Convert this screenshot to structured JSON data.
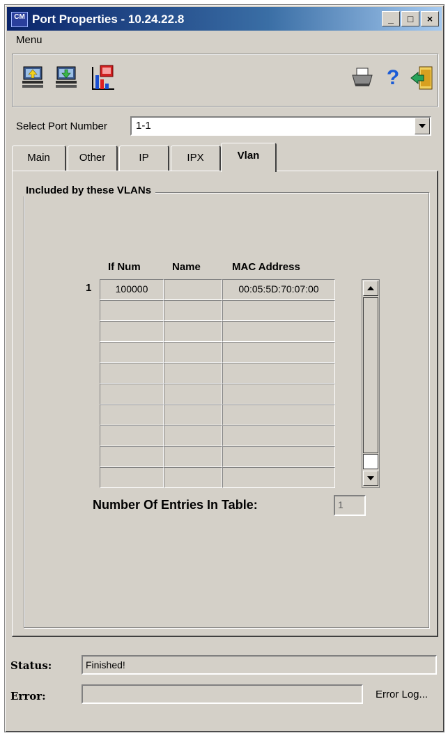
{
  "window": {
    "title": "Port Properties - 10.24.22.8",
    "app_icon_text": "CM",
    "minimize": "_",
    "maximize": "□",
    "close": "×"
  },
  "menu": {
    "items": [
      "Menu"
    ]
  },
  "toolbar": {
    "icons": [
      "upload-icon",
      "download-icon",
      "bar-chart-icon",
      "printer-icon",
      "help-icon",
      "exit-icon"
    ],
    "help_glyph": "?"
  },
  "port_select": {
    "label": "Select Port Number",
    "value": "1-1"
  },
  "tabs": [
    {
      "label": "Main",
      "active": false
    },
    {
      "label": "Other",
      "active": false
    },
    {
      "label": "IP",
      "active": false
    },
    {
      "label": "IPX",
      "active": false
    },
    {
      "label": "Vlan",
      "active": true
    }
  ],
  "vlan": {
    "group_title": "Included by these VLANs",
    "columns": [
      "If Num",
      "Name",
      "MAC Address"
    ],
    "row_numbers": [
      "1"
    ],
    "rows": [
      [
        "100000",
        "",
        "00:05:5D:70:07:00"
      ],
      [
        "",
        "",
        ""
      ],
      [
        "",
        "",
        ""
      ],
      [
        "",
        "",
        ""
      ],
      [
        "",
        "",
        ""
      ],
      [
        "",
        "",
        ""
      ],
      [
        "",
        "",
        ""
      ],
      [
        "",
        "",
        ""
      ],
      [
        "",
        "",
        ""
      ],
      [
        "",
        "",
        ""
      ]
    ],
    "count_label": "Number Of Entries In Table:",
    "count_value": "1"
  },
  "status": {
    "label": "Status:",
    "value": "Finished!"
  },
  "error": {
    "label": "Error:",
    "value": "",
    "log_link": "Error Log..."
  },
  "colors": {
    "title_bar": "#0a246a",
    "face": "#d4d0c8"
  }
}
